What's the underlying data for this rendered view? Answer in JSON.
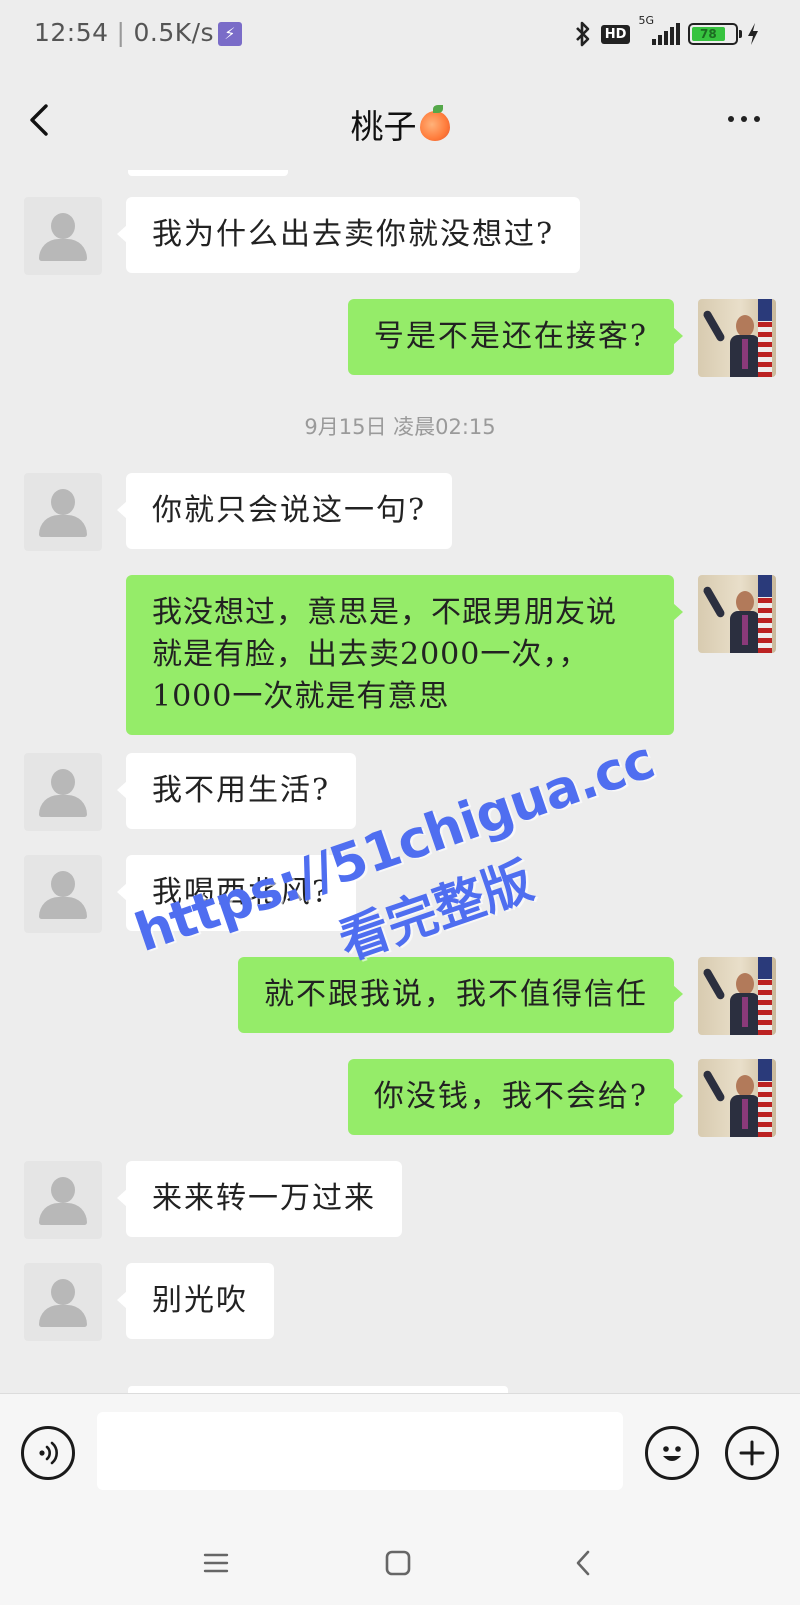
{
  "status_bar": {
    "time": "12:54",
    "net_speed": "0.5K/s",
    "network": "5G",
    "hd": "HD",
    "battery": "78",
    "icons": [
      "bolt-icon",
      "bluetooth-icon",
      "hd-icon",
      "signal-icon",
      "battery-icon",
      "charging-icon"
    ]
  },
  "header": {
    "title": "桃子",
    "title_emoji": "peach-icon",
    "back_icon": "chevron-left-icon",
    "more_icon": "more-dots-icon"
  },
  "messages": [
    {
      "side": "in",
      "text": "我为什么出去卖你就没想过?"
    },
    {
      "side": "out",
      "text": "号是不是还在接客?"
    },
    {
      "side": "time",
      "text": "9月15日 凌晨02:15"
    },
    {
      "side": "in",
      "text": "你就只会说这一句?"
    },
    {
      "side": "out",
      "text": "我没想过，意思是，不跟男朋友说\n就是有脸，出去卖2000一次，，\n1000一次就是有意思"
    },
    {
      "side": "in",
      "text": "我不用生活?"
    },
    {
      "side": "in",
      "text": "我喝西北风?"
    },
    {
      "side": "out",
      "text": "就不跟我说，我不值得信任"
    },
    {
      "side": "out",
      "text": "你没钱，我不会给?"
    },
    {
      "side": "in",
      "text": "来来转一万过来"
    },
    {
      "side": "in",
      "text": "别光吹"
    }
  ],
  "watermark": {
    "url": "https://51chigua.cc",
    "cta": "看完整版"
  },
  "input_bar": {
    "value": "",
    "voice_icon": "voice-icon",
    "emoji_icon": "emoji-icon",
    "plus_icon": "plus-icon"
  },
  "nav_bar": {
    "icons": [
      "menu-icon",
      "home-square-icon",
      "back-triangle-icon"
    ]
  },
  "colors": {
    "background": "#ededed",
    "bubble_out": "#95ec69",
    "bubble_in": "#ffffff",
    "watermark": "#4f6ef0"
  }
}
